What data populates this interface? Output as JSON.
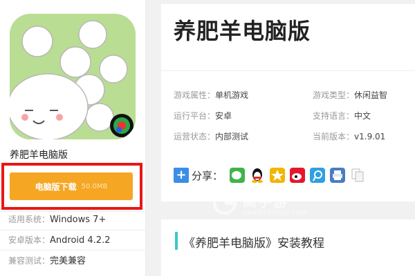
{
  "sidebar": {
    "app_name": "养肥羊电脑版",
    "download": {
      "label": "电脑版下载",
      "size": "50.0MB"
    },
    "specs": [
      {
        "key": "适用系统：",
        "value": "Windows 7+"
      },
      {
        "key": "安卓版本：",
        "value": "Android 4.2.2"
      },
      {
        "key": "兼容测试：",
        "value": "完美兼容"
      }
    ]
  },
  "main": {
    "title": "养肥羊电脑版",
    "attributes": [
      {
        "key": "游戏属性：",
        "value": "单机游戏"
      },
      {
        "key": "游戏类型：",
        "value": "休闲益智"
      },
      {
        "key": "运行平台：",
        "value": "安卓"
      },
      {
        "key": "支持语言：",
        "value": "中文"
      },
      {
        "key": "运营状态：",
        "value": "内部测试"
      },
      {
        "key": "当前版本：",
        "value": "v1.9.01"
      }
    ],
    "share": {
      "label": "分享：",
      "icons": [
        "wechat-icon",
        "qq-icon",
        "qzone-icon",
        "weibo-icon",
        "tencent-weibo-icon",
        "print-icon",
        "copy-icon"
      ]
    }
  },
  "section": {
    "title": "《养肥羊电脑版》安装教程"
  },
  "watermark": {
    "brand": "高手游",
    "domain": "GAOSHOUYOU.COM"
  },
  "colors": {
    "download_button": "#f5a623",
    "highlight_frame": "#e81616",
    "section_bar": "#3ec6c6",
    "share_plus": "#3b8ee6"
  }
}
